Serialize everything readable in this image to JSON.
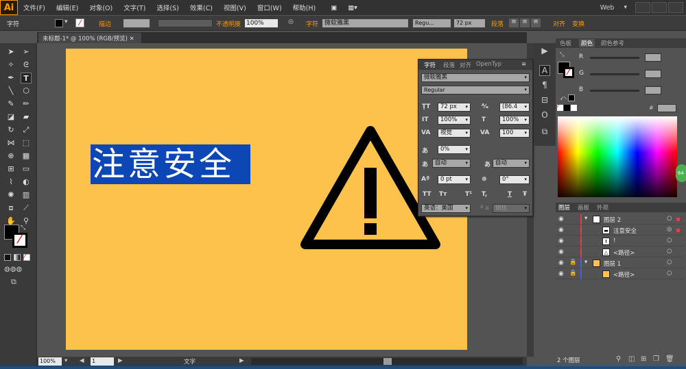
{
  "app": {
    "logo": "Ai"
  },
  "menu": [
    "文件(F)",
    "编辑(E)",
    "对象(O)",
    "文字(T)",
    "选择(S)",
    "效果(C)",
    "视图(V)",
    "窗口(W)",
    "帮助(H)"
  ],
  "workspace": "Web",
  "control": {
    "type_label": "字符",
    "stroke_label": "描边",
    "opacity_label": "不透明度",
    "opacity": "100%",
    "char_link": "字符",
    "font": "微软雅黑",
    "style": "Regu...",
    "size": "72 px",
    "para_label": "段落",
    "align_label": "对齐",
    "transform_label": "变换"
  },
  "document": {
    "tab": "未标题-1* @ 100% (RGB/预览)"
  },
  "canvas": {
    "selected_text": "注意安全"
  },
  "status": {
    "zoom": "100%",
    "page": "1",
    "tool": "文字"
  },
  "char_panel": {
    "tabs": [
      "字符",
      "段落",
      "对齐",
      "OpenTyp"
    ],
    "font": "微软雅黑",
    "style": "Regular",
    "size": "72 px",
    "leading": "(86.4",
    "vscale": "100%",
    "hscale": "100%",
    "kern": "视觉",
    "track": "100",
    "tsume": "0%",
    "aki_left": "自动",
    "aki_right": "自动",
    "baseline": "0 pt",
    "rotation": "0°",
    "tt_row": [
      "TT",
      "Tт",
      "T¹",
      "T,",
      "T",
      "Ŧ"
    ],
    "language": "英语：美国",
    "aa_prefix": "ª a",
    "antialias": "锐化"
  },
  "color_panel": {
    "tabs": [
      "色板",
      "颜色",
      "颜色参考"
    ],
    "channels": [
      "R",
      "G",
      "B"
    ]
  },
  "layers_panel": {
    "tabs": [
      "图层",
      "画板",
      "外观"
    ],
    "layers": [
      {
        "name": "图层 2",
        "level": 0,
        "color": "#e04040"
      },
      {
        "name": "注意安全",
        "level": 1,
        "color": "#e04040"
      },
      {
        "name": "!",
        "level": 1,
        "color": "#e04040"
      },
      {
        "name": "<路径>",
        "level": 1,
        "color": "#e04040"
      },
      {
        "name": "图层 1",
        "level": 0,
        "color": "#4060e0"
      },
      {
        "name": "<路径>",
        "level": 1,
        "color": "#4060e0"
      }
    ],
    "footer": "2 个图层"
  },
  "colors": {
    "artboard": "#fdc24b",
    "selection": "#0d47b5",
    "accent": "#ff9a00"
  }
}
